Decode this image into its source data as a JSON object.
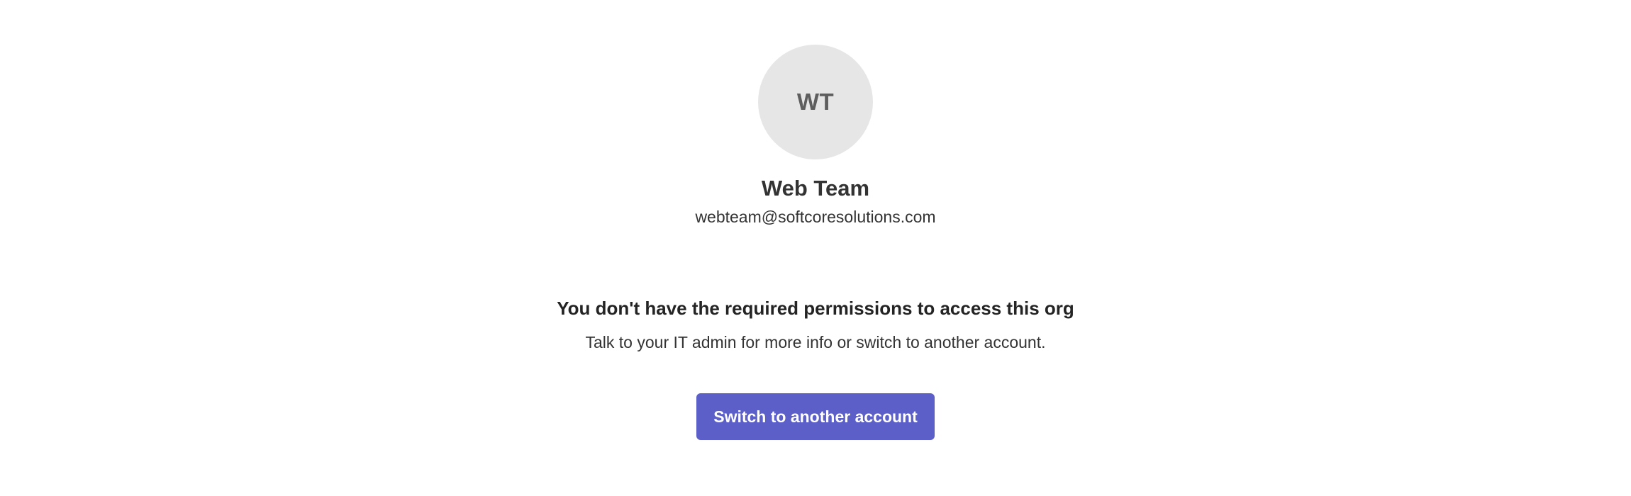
{
  "account": {
    "initials": "WT",
    "name": "Web Team",
    "email": "webteam@softcoresolutions.com"
  },
  "message": {
    "title": "You don't have the required permissions to access this org",
    "subtitle": "Talk to your IT admin for more info or switch to another account."
  },
  "actions": {
    "switch_label": "Switch to another account"
  },
  "colors": {
    "accent": "#5b5fc7",
    "avatar_bg": "#e6e6e6"
  }
}
